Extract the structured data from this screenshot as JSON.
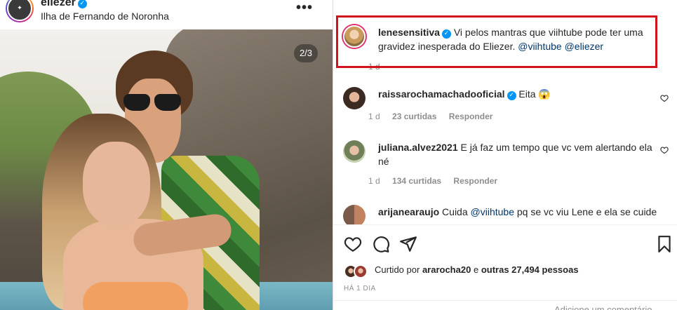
{
  "post": {
    "username": "eliezer",
    "location": "Ilha de Fernando de Noronha",
    "more_label": "•••",
    "carousel_counter": "2/3"
  },
  "comments": [
    {
      "username": "lenesensitiva",
      "text": "Vi pelos mantras que viihtube pode ter uma gravidez inesperada do Eliezer.",
      "mentions": [
        "@viihtube",
        "@eliezer"
      ],
      "time": "1 d"
    },
    {
      "username": "raissarochamachadooficial",
      "text": "Eita 😱",
      "time": "1 d",
      "likes": "23 curtidas",
      "reply": "Responder"
    },
    {
      "username": "juliana.alvez2021",
      "text": "E já faz um tempo que vc vem alertando ela né",
      "time": "1 d",
      "likes": "134 curtidas",
      "reply": "Responder"
    },
    {
      "username": "arijanearaujo",
      "text_before": "Cuida",
      "mention": "@viihtube",
      "text_after": "pq se vc viu Lene e ela se cuide"
    }
  ],
  "liked": {
    "prefix": "Curtido por",
    "user": "ararocha20",
    "middle": "e",
    "others": "outras 27,494 pessoas"
  },
  "time_ago": "HÁ 1 DIA",
  "add_comment_placeholder": "Adicione um comentário...",
  "colors": {
    "highlight": "#d0141c",
    "verified": "#0095f6",
    "mention": "#00376b"
  }
}
